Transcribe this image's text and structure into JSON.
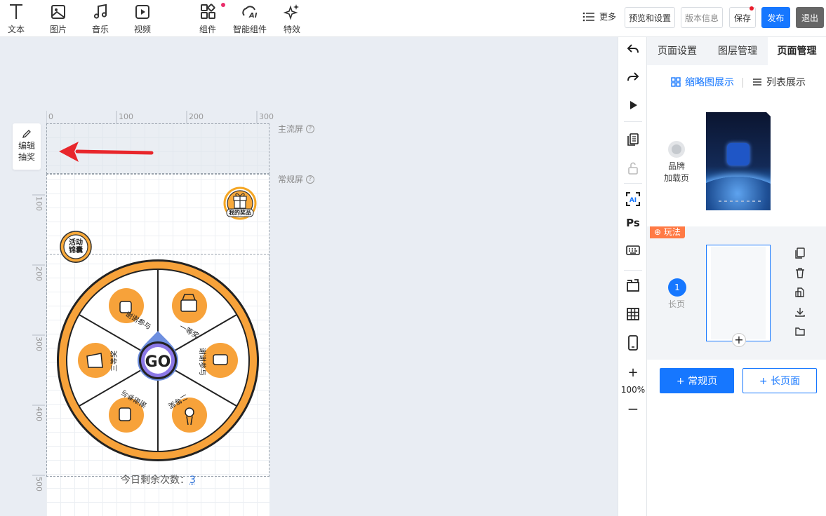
{
  "toolbar": {
    "tools": [
      {
        "label": "文本",
        "icon": "text-icon"
      },
      {
        "label": "图片",
        "icon": "image-icon"
      },
      {
        "label": "音乐",
        "icon": "music-icon"
      },
      {
        "label": "视频",
        "icon": "video-icon"
      },
      {
        "label": "组件",
        "icon": "component-icon",
        "has_badge": true
      },
      {
        "label": "智能组件",
        "icon": "ai-component-icon"
      },
      {
        "label": "特效",
        "icon": "effects-icon"
      }
    ],
    "more_label": "更多",
    "buttons": {
      "preview": "预览和设置",
      "version": "版本信息",
      "save": "保存",
      "publish": "发布",
      "exit": "退出"
    },
    "badge_color": "#ea2d6b",
    "publish_color": "#1677ff"
  },
  "canvas": {
    "side_tool_label_1": "编辑",
    "side_tool_label_2": "抽奖",
    "ruler_top": [
      "0",
      "100",
      "200",
      "300"
    ],
    "ruler_left": [
      "100",
      "200",
      "300",
      "400",
      "500"
    ],
    "mainstream_screen_label": "主流屏",
    "normal_screen_label": "常规屏",
    "help_glyph": "?",
    "my_prizes_label": "我的奖品",
    "activity_label_1": "活动",
    "activity_label_2": "锦囊",
    "wheel": {
      "center_label": "GO",
      "segments": [
        "一等奖",
        "谢谢参与",
        "二等奖",
        "谢谢参与",
        "三等奖",
        "谢谢参与"
      ],
      "ring_color": "#f7a23a",
      "center_color": "#7b6be0"
    },
    "remaining_label": "今日剩余次数：",
    "remaining_count": "3"
  },
  "vtoolbar": {
    "zoom": "100%",
    "ai_label": "AI",
    "ps_label": "Ps"
  },
  "panel": {
    "tabs": [
      "页面设置",
      "图层管理",
      "页面管理"
    ],
    "active_tab": "页面管理",
    "view_thumbnail": "缩略图展示",
    "view_list": "列表展示",
    "brand_label_1": "品牌",
    "brand_label_2": "加载页",
    "play_tag": "玩法",
    "page_number": "1",
    "page_type": "长页",
    "add_normal_page": "+ 常规页",
    "add_long_page": "+ 长页面",
    "accent_color": "#1677ff",
    "play_tag_color": "#ff7a45"
  }
}
